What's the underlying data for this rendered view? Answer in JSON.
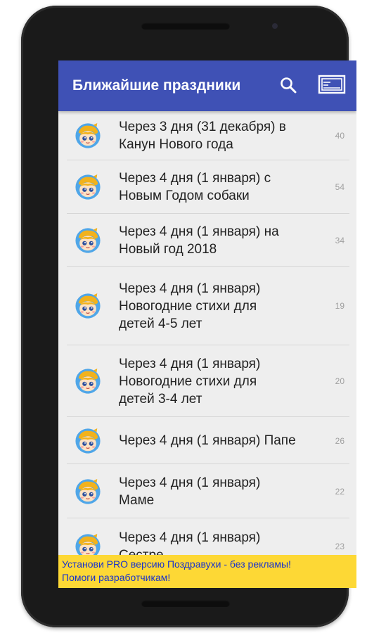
{
  "appbar": {
    "title": "Ближайшие праздники",
    "color": "#3f51b5",
    "icons": [
      "search-icon",
      "cast-icon"
    ]
  },
  "list": {
    "items": [
      {
        "lines": [
          "Через 3 дня (31 декабря) в",
          "Канун Нового года"
        ],
        "count": "40",
        "icon": "child-avatar-icon"
      },
      {
        "lines": [
          "Через 4 дня (1 января) с",
          "Новым Годом собаки"
        ],
        "count": "54",
        "icon": "child-avatar-icon"
      },
      {
        "lines": [
          "Через 4 дня (1 января) на",
          "Новый год 2018"
        ],
        "count": "34",
        "icon": "child-avatar-icon"
      },
      {
        "lines": [
          "Через 4 дня (1 января)",
          "Новогодние стихи для",
          "детей 4-5 лет"
        ],
        "count": "19",
        "icon": "child-avatar-icon"
      },
      {
        "lines": [
          "Через 4 дня (1 января)",
          "Новогодние стихи для",
          "детей 3-4 лет"
        ],
        "count": "20",
        "icon": "child-avatar-icon"
      },
      {
        "lines": [
          "Через 4 дня (1 января) Папе"
        ],
        "count": "26",
        "icon": "child-avatar-icon"
      },
      {
        "lines": [
          "Через 4 дня (1 января)",
          "Маме"
        ],
        "count": "22",
        "icon": "child-avatar-icon"
      },
      {
        "lines": [
          "Через 4 дня (1 января)",
          "Сестре"
        ],
        "count": "23",
        "icon": "child-avatar-icon"
      }
    ]
  },
  "banner": {
    "line1": "Установи PRO версию Поздравухи - без рекламы!",
    "line2": "Помоги разработчикам!",
    "background": "#fdd835",
    "text_color": "#1a33cc"
  }
}
